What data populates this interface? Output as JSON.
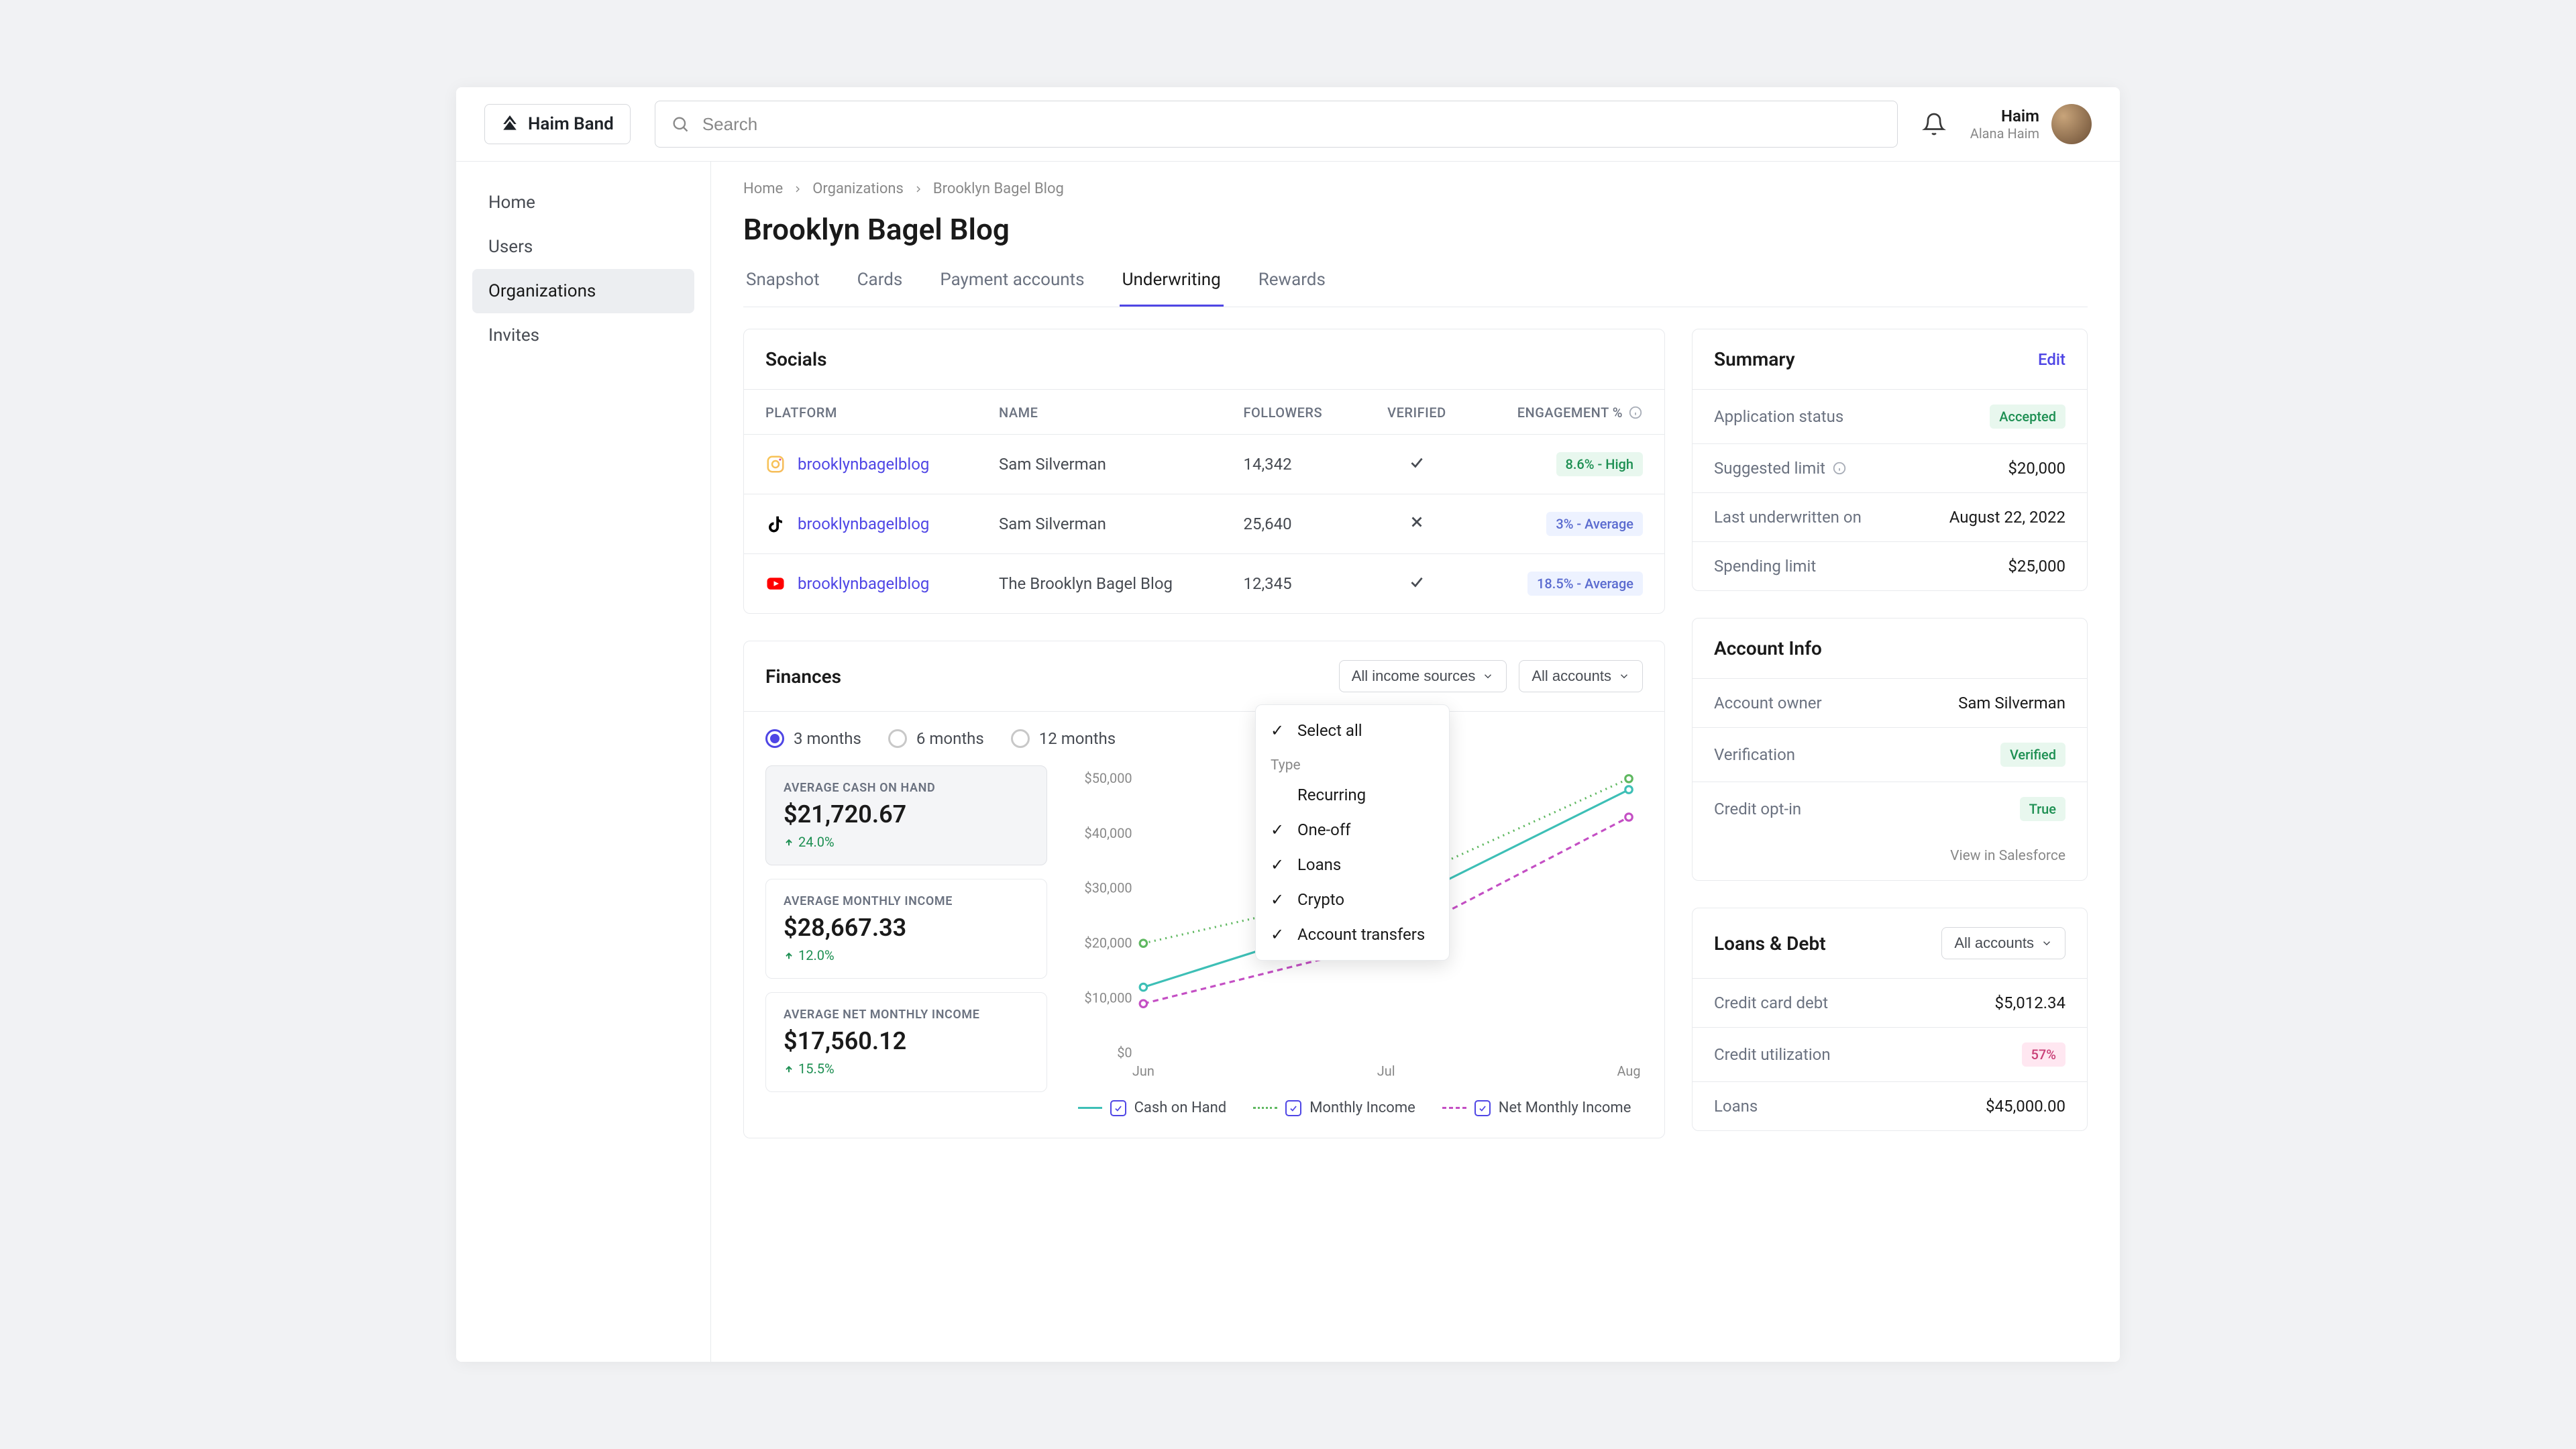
{
  "brand": "Haim Band",
  "search": {
    "placeholder": "Search"
  },
  "user": {
    "name": "Haim",
    "sub": "Alana Haim"
  },
  "sidebar": {
    "items": [
      "Home",
      "Users",
      "Organizations",
      "Invites"
    ],
    "activeIndex": 2
  },
  "breadcrumb": [
    "Home",
    "Organizations",
    "Brooklyn Bagel Blog"
  ],
  "page_title": "Brooklyn Bagel Blog",
  "tabs": {
    "items": [
      "Snapshot",
      "Cards",
      "Payment accounts",
      "Underwriting",
      "Rewards"
    ],
    "activeIndex": 3
  },
  "socials": {
    "title": "Socials",
    "headers": [
      "PLATFORM",
      "NAME",
      "FOLLOWERS",
      "VERIFIED",
      "ENGAGEMENT %"
    ],
    "rows": [
      {
        "platform": "instagram",
        "handle": "brooklynbagelblog",
        "name": "Sam Silverman",
        "followers": "14,342",
        "verified": true,
        "engagement": "8.6% - High",
        "badge_class": "badge-green"
      },
      {
        "platform": "tiktok",
        "handle": "brooklynbagelblog",
        "name": "Sam Silverman",
        "followers": "25,640",
        "verified": false,
        "engagement": "3% - Average",
        "badge_class": "badge-blue"
      },
      {
        "platform": "youtube",
        "handle": "brooklynbagelblog",
        "name": "The Brooklyn Bagel Blog",
        "followers": "12,345",
        "verified": true,
        "engagement": "18.5% - Average",
        "badge_class": "badge-blue"
      }
    ]
  },
  "finances": {
    "title": "Finances",
    "filters": {
      "sources": "All income sources",
      "accounts": "All accounts"
    },
    "ranges": [
      "3 months",
      "6 months",
      "12 months"
    ],
    "range_active": 0,
    "stats": [
      {
        "label": "AVERAGE CASH ON HAND",
        "value": "$21,720.67",
        "delta": "24.0%",
        "active": true
      },
      {
        "label": "AVERAGE MONTHLY INCOME",
        "value": "$28,667.33",
        "delta": "12.0%",
        "active": false
      },
      {
        "label": "AVERAGE NET MONTHLY INCOME",
        "value": "$17,560.12",
        "delta": "15.5%",
        "active": false
      }
    ],
    "legend": [
      "Cash on Hand",
      "Monthly Income",
      "Net Monthly Income"
    ],
    "dropdown": {
      "select_all": "Select all",
      "type_label": "Type",
      "options": [
        {
          "label": "Recurring",
          "checked": false
        },
        {
          "label": "One-off",
          "checked": true
        },
        {
          "label": "Loans",
          "checked": true
        },
        {
          "label": "Crypto",
          "checked": true
        },
        {
          "label": "Account transfers",
          "checked": true
        }
      ]
    }
  },
  "chart_data": {
    "type": "line",
    "x": [
      "Jun",
      "Jul",
      "Aug"
    ],
    "y_ticks": [
      "$0",
      "$10,000",
      "$20,000",
      "$30,000",
      "$40,000",
      "$50,000"
    ],
    "ylim": [
      0,
      50000
    ],
    "series": [
      {
        "name": "Cash on Hand",
        "color": "#3dbfb6",
        "style": "solid",
        "values": [
          12000,
          26000,
          48000
        ]
      },
      {
        "name": "Monthly Income",
        "color": "#5fb860",
        "style": "dotted",
        "values": [
          20000,
          30000,
          50000
        ]
      },
      {
        "name": "Net Monthly Income",
        "color": "#c44fc4",
        "style": "dashed",
        "values": [
          9000,
          20000,
          43000
        ]
      }
    ]
  },
  "summary": {
    "title": "Summary",
    "edit": "Edit",
    "rows": [
      {
        "key": "Application status",
        "val": "Accepted",
        "val_badge": "badge-green"
      },
      {
        "key": "Suggested limit",
        "val": "$20,000",
        "info": true
      },
      {
        "key": "Last underwritten on",
        "val": "August 22, 2022"
      },
      {
        "key": "Spending limit",
        "val": "$25,000"
      }
    ]
  },
  "account_info": {
    "title": "Account Info",
    "rows": [
      {
        "key": "Account owner",
        "val": "Sam Silverman"
      },
      {
        "key": "Verification",
        "val": "Verified",
        "val_badge": "badge-green"
      },
      {
        "key": "Credit opt-in",
        "val": "True",
        "val_badge": "badge-green"
      }
    ],
    "footer_link": "View in Salesforce"
  },
  "loans": {
    "title": "Loans & Debt",
    "filter": "All accounts",
    "rows": [
      {
        "key": "Credit card debt",
        "val": "$5,012.34"
      },
      {
        "key": "Credit utilization",
        "val": "57%",
        "val_badge": "badge-pink"
      },
      {
        "key": "Loans",
        "val": "$45,000.00"
      }
    ]
  }
}
